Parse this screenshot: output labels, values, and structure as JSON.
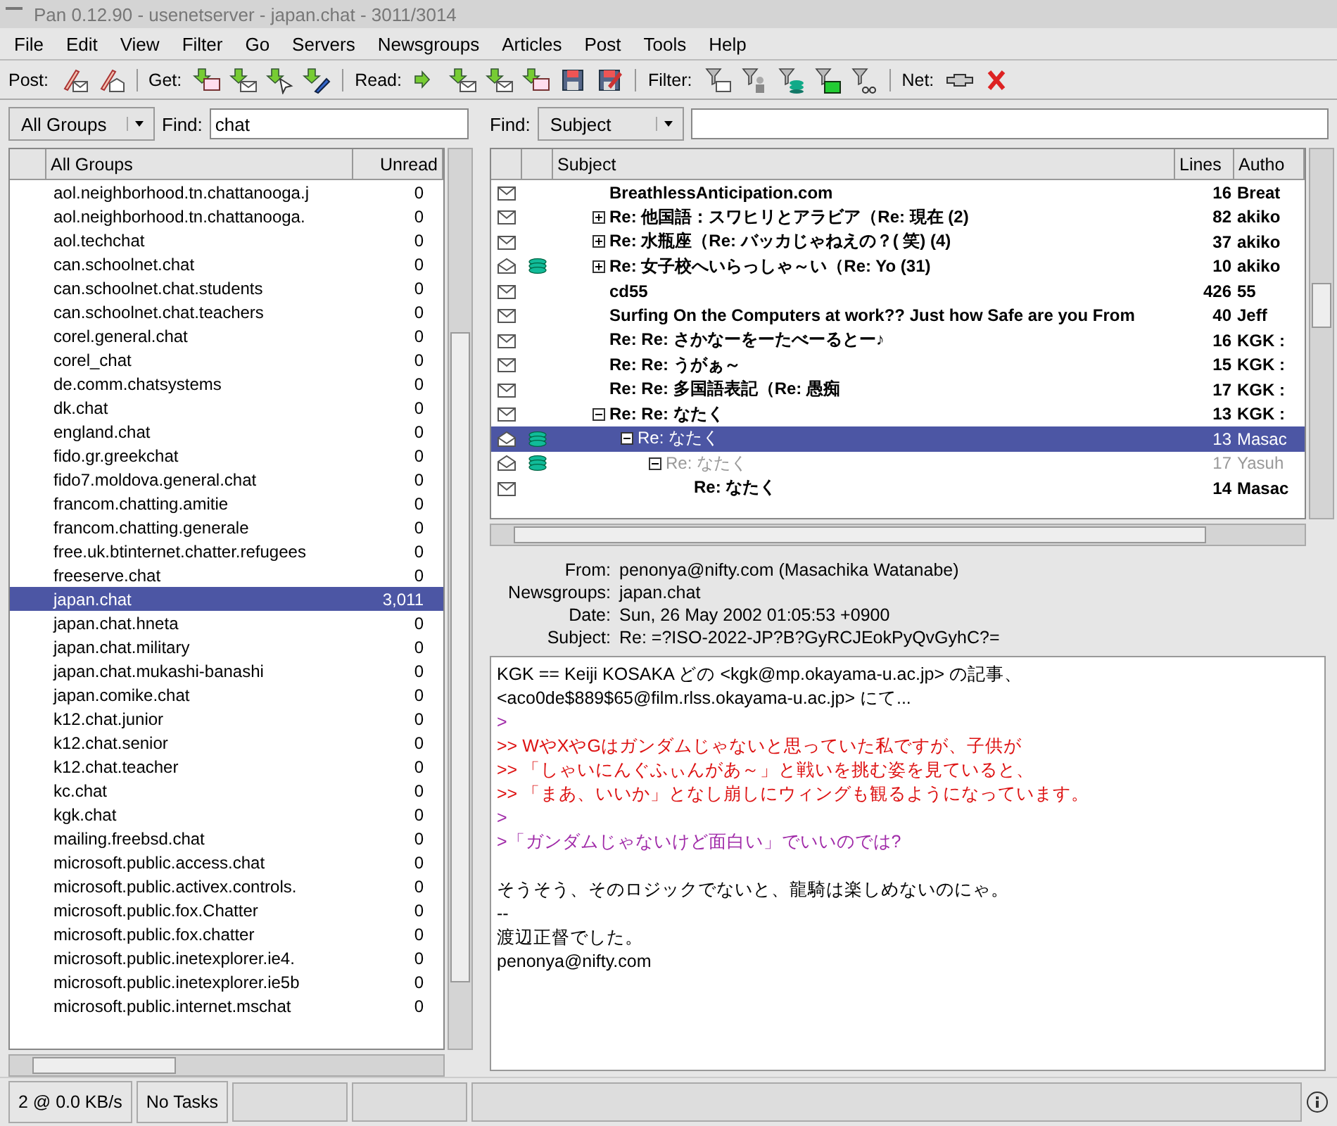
{
  "window": {
    "title": "Pan 0.12.90  - usenetserver - japan.chat - 3011/3014"
  },
  "menu": [
    "File",
    "Edit",
    "View",
    "Filter",
    "Go",
    "Servers",
    "Newsgroups",
    "Articles",
    "Post",
    "Tools",
    "Help"
  ],
  "toolbar": [
    {
      "label": "Post:"
    },
    {
      "label": "Get:"
    },
    {
      "label": "Read:"
    },
    {
      "label": "Filter:"
    },
    {
      "label": "Net:"
    }
  ],
  "group_filter": {
    "dropdown": "All Groups",
    "find_label": "Find:",
    "find_value": "chat"
  },
  "article_filter": {
    "find_label": "Find:",
    "dropdown": "Subject"
  },
  "groups": {
    "columns": [
      "All Groups",
      "Unread"
    ],
    "rows": [
      {
        "name": "aol.neighborhood.tn.chattanooga.j",
        "unread": "0",
        "selected": false
      },
      {
        "name": "aol.neighborhood.tn.chattanooga.",
        "unread": "0",
        "selected": false
      },
      {
        "name": "aol.techchat",
        "unread": "0",
        "selected": false
      },
      {
        "name": "can.schoolnet.chat",
        "unread": "0",
        "selected": false
      },
      {
        "name": "can.schoolnet.chat.students",
        "unread": "0",
        "selected": false
      },
      {
        "name": "can.schoolnet.chat.teachers",
        "unread": "0",
        "selected": false
      },
      {
        "name": "corel.general.chat",
        "unread": "0",
        "selected": false
      },
      {
        "name": "corel_chat",
        "unread": "0",
        "selected": false
      },
      {
        "name": "de.comm.chatsystems",
        "unread": "0",
        "selected": false
      },
      {
        "name": "dk.chat",
        "unread": "0",
        "selected": false
      },
      {
        "name": "england.chat",
        "unread": "0",
        "selected": false
      },
      {
        "name": "fido.gr.greekchat",
        "unread": "0",
        "selected": false
      },
      {
        "name": "fido7.moldova.general.chat",
        "unread": "0",
        "selected": false
      },
      {
        "name": "francom.chatting.amitie",
        "unread": "0",
        "selected": false
      },
      {
        "name": "francom.chatting.generale",
        "unread": "0",
        "selected": false
      },
      {
        "name": "free.uk.btinternet.chatter.refugees",
        "unread": "0",
        "selected": false
      },
      {
        "name": "freeserve.chat",
        "unread": "0",
        "selected": false
      },
      {
        "name": "japan.chat",
        "unread": "3,011",
        "selected": true
      },
      {
        "name": "japan.chat.hneta",
        "unread": "0",
        "selected": false
      },
      {
        "name": "japan.chat.military",
        "unread": "0",
        "selected": false
      },
      {
        "name": "japan.chat.mukashi-banashi",
        "unread": "0",
        "selected": false
      },
      {
        "name": "japan.comike.chat",
        "unread": "0",
        "selected": false
      },
      {
        "name": "k12.chat.junior",
        "unread": "0",
        "selected": false
      },
      {
        "name": "k12.chat.senior",
        "unread": "0",
        "selected": false
      },
      {
        "name": "k12.chat.teacher",
        "unread": "0",
        "selected": false
      },
      {
        "name": "kc.chat",
        "unread": "0",
        "selected": false
      },
      {
        "name": "kgk.chat",
        "unread": "0",
        "selected": false
      },
      {
        "name": "mailing.freebsd.chat",
        "unread": "0",
        "selected": false
      },
      {
        "name": "microsoft.public.access.chat",
        "unread": "0",
        "selected": false
      },
      {
        "name": "microsoft.public.activex.controls.",
        "unread": "0",
        "selected": false
      },
      {
        "name": "microsoft.public.fox.Chatter",
        "unread": "0",
        "selected": false
      },
      {
        "name": "microsoft.public.fox.chatter",
        "unread": "0",
        "selected": false
      },
      {
        "name": "microsoft.public.inetexplorer.ie4.",
        "unread": "0",
        "selected": false
      },
      {
        "name": "microsoft.public.inetexplorer.ie5b",
        "unread": "0",
        "selected": false
      },
      {
        "name": "microsoft.public.internet.mschat",
        "unread": "0",
        "selected": false
      }
    ]
  },
  "articles": {
    "columns": [
      "Subject",
      "Lines",
      "Autho"
    ],
    "rows": [
      {
        "subject": "BreathlessAnticipation.com",
        "lines": "16",
        "author": "Breat",
        "opened": false,
        "cached": false,
        "unread": true,
        "selected": false
      },
      {
        "subject": "Re: 他国語：スワヒリとアラビア（Re:  現在 (2)",
        "lines": "82",
        "author": "akiko",
        "opened": false,
        "cached": false,
        "unread": true,
        "selected": false,
        "expanded": false
      },
      {
        "subject": "Re: 水瓶座（Re:  バッカじゃねえの？(  笑)    (4)",
        "lines": "37",
        "author": "akiko",
        "opened": false,
        "cached": false,
        "unread": true,
        "selected": false,
        "expanded": false
      },
      {
        "subject": "Re: 女子校へいらっしゃ～い（Re: Yo (31)",
        "lines": "10",
        "author": "akiko",
        "opened": true,
        "cached": true,
        "unread": true,
        "selected": false,
        "expanded": false
      },
      {
        "subject": "cd55",
        "lines": "426",
        "author": "55",
        "opened": false,
        "cached": false,
        "unread": true,
        "selected": false
      },
      {
        "subject": "Surfing On the Computers at work?? Just how Safe are you From",
        "lines": "40",
        "author": "Jeff",
        "opened": false,
        "cached": false,
        "unread": true,
        "selected": false
      },
      {
        "subject": "Re: Re: さかなーをーたべーるとー♪",
        "lines": "16",
        "author": "KGK :",
        "opened": false,
        "cached": false,
        "unread": true,
        "selected": false
      },
      {
        "subject": "Re: Re: うがぁ～",
        "lines": "15",
        "author": "KGK :",
        "opened": false,
        "cached": false,
        "unread": true,
        "selected": false
      },
      {
        "subject": "Re: Re: 多国語表記（Re: 愚痴",
        "lines": "17",
        "author": "KGK :",
        "opened": false,
        "cached": false,
        "unread": true,
        "selected": false
      },
      {
        "subject": "Re: Re: なたく",
        "lines": "13",
        "author": "KGK :",
        "opened": false,
        "cached": false,
        "unread": true,
        "selected": false,
        "expanded": true,
        "children": [
          {
            "subject": "Re: なたく",
            "lines": "13",
            "author": "Masac",
            "opened": true,
            "cached": true,
            "unread": false,
            "selected": true,
            "expanded": true,
            "children": [
              {
                "subject": "Re: なたく",
                "lines": "17",
                "author": "Yasuh",
                "opened": true,
                "cached": true,
                "unread": false,
                "selected": false,
                "expanded": true,
                "children": [
                  {
                    "subject": "Re: なたく",
                    "lines": "14",
                    "author": "Masac",
                    "opened": false,
                    "cached": false,
                    "unread": true,
                    "selected": false
                  }
                ]
              }
            ]
          }
        ]
      }
    ]
  },
  "headers": [
    {
      "label": "From:",
      "value": "penonya@nifty.com (Masachika Watanabe)"
    },
    {
      "label": "Newsgroups:",
      "value": "japan.chat"
    },
    {
      "label": "Date:",
      "value": "Sun, 26 May 2002 01:05:53 +0900"
    },
    {
      "label": "Subject:",
      "value": "Re: =?ISO-2022-JP?B?GyRCJEokPyQvGyhC?="
    }
  ],
  "body": [
    {
      "kind": "text",
      "text": "KGK == Keiji KOSAKA どの <kgk@mp.okayama-u.ac.jp> の記事、"
    },
    {
      "kind": "text",
      "text": "<aco0de$889$65@film.rlss.okayama-u.ac.jp> にて..."
    },
    {
      "kind": "quote1",
      "text": ">"
    },
    {
      "kind": "quote2",
      "text": ">> WやXやGはガンダムじゃないと思っていた私ですが、子供が"
    },
    {
      "kind": "quote2",
      "text": ">> 「しゃいにんぐふぃんがあ～」と戦いを挑む姿を見ていると、"
    },
    {
      "kind": "quote2",
      "text": ">> 「まあ、いいか」となし崩しにウィングも観るようになっています。"
    },
    {
      "kind": "quote1",
      "text": ">"
    },
    {
      "kind": "quote1",
      "text": ">「ガンダムじゃないけど面白い」でいいのでは?"
    },
    {
      "kind": "blank"
    },
    {
      "kind": "text",
      "text": "そうそう、そのロジックでないと、龍騎は楽しめないのにゃ。"
    },
    {
      "kind": "text",
      "text": "--"
    },
    {
      "kind": "text",
      "text": "渡辺正督でした。"
    },
    {
      "kind": "text",
      "text": "penonya@nifty.com"
    }
  ],
  "status_bar": [
    "2 @ 0.0 KB/s",
    "No Tasks"
  ]
}
